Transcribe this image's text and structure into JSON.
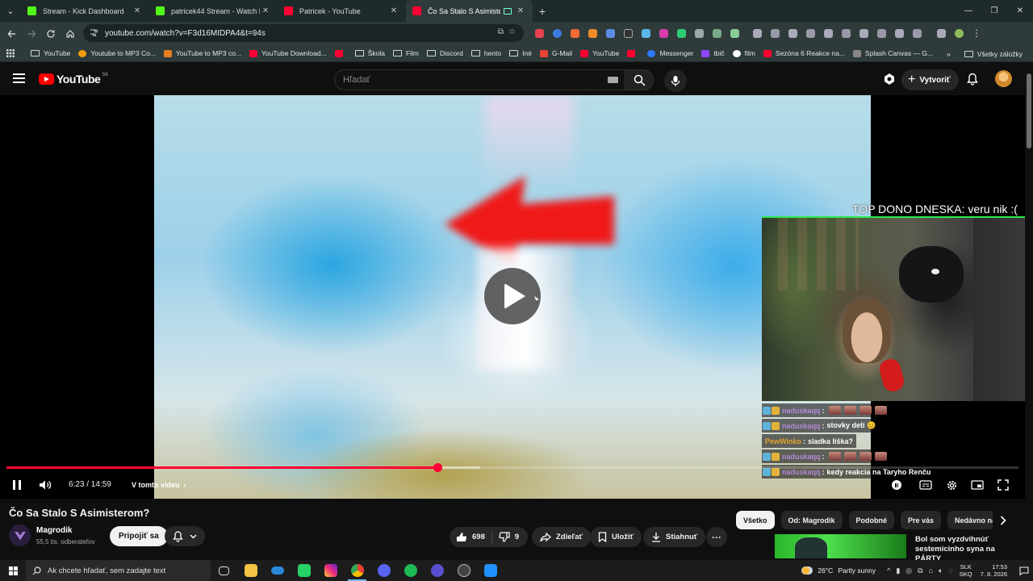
{
  "browser": {
    "tabs": [
      {
        "label": "Stream - Kick Dashboard",
        "favicon_color": "#53fc18",
        "active": false
      },
      {
        "label": "patricek44 Stream - Watch Live",
        "favicon_color": "#53fc18",
        "active": false
      },
      {
        "label": "Patricek - YouTube",
        "favicon_color": "#ff0033",
        "active": false
      },
      {
        "label": "Čo Sa Stalo S Asimisterom?",
        "favicon_color": "#ff0033",
        "active": true
      }
    ],
    "url": "youtube.com/watch?v=F3d16MIDPA4&t=94s",
    "bookmarks": [
      {
        "label": "YouTube",
        "type": "folder"
      },
      {
        "label": "Youtube to MP3 Co...",
        "type": "site",
        "color": "#f39c12"
      },
      {
        "label": "YouTube to MP3 co...",
        "type": "site",
        "color": "#e67e22"
      },
      {
        "label": "YouTube Download...",
        "type": "site",
        "color": "#ff0033"
      },
      {
        "label": "",
        "type": "site",
        "color": "#ff0033"
      },
      {
        "label": "Škola",
        "type": "folder"
      },
      {
        "label": "Film",
        "type": "folder"
      },
      {
        "label": "Discord",
        "type": "folder"
      },
      {
        "label": "hento",
        "type": "folder"
      },
      {
        "label": "Iné",
        "type": "folder"
      },
      {
        "label": "G-Mail",
        "type": "site",
        "color": "#ea4335"
      },
      {
        "label": "YouTube",
        "type": "site",
        "color": "#ff0033"
      },
      {
        "label": "",
        "type": "site",
        "color": "#ff0033"
      },
      {
        "label": "Messenger",
        "type": "site",
        "color": "#2f7bff"
      },
      {
        "label": "tbič",
        "type": "site",
        "color": "#9146ff"
      },
      {
        "label": "film",
        "type": "site",
        "color": "#ffffff"
      },
      {
        "label": "Sezóna 6 Reakce na...",
        "type": "site",
        "color": "#ff0033"
      },
      {
        "label": "Splash Canvas — G...",
        "type": "site",
        "color": "#888888"
      }
    ],
    "all_bookmarks": "Všetky záložky"
  },
  "youtube": {
    "region": "SK",
    "search_placeholder": "Hľadať",
    "create_label": "Vytvoriť"
  },
  "player": {
    "top_dono": "TOP DONO DNESKA: veru nik :(",
    "time": "6:23 / 14:59",
    "chapter": "V tomto videu",
    "played_fraction": 0.426,
    "buffered_fraction": 0.468,
    "chat": [
      {
        "user": "naduskaqq",
        "user_color": "#b58ad8",
        "msg": "",
        "emotes": 4
      },
      {
        "user": "naduskaqq",
        "user_color": "#b58ad8",
        "msg": "stovky deti 😊",
        "emotes": 0
      },
      {
        "user": "PewWinko",
        "user_color": "#e6a52b",
        "msg": "sladka liška?",
        "emotes": 0
      },
      {
        "user": "naduskaqq",
        "user_color": "#b58ad8",
        "msg": "",
        "emotes": 4
      },
      {
        "user": "naduskaqq",
        "user_color": "#b58ad8",
        "msg": "kedy reakcia na Taryho Renču",
        "emotes": 0
      }
    ]
  },
  "video": {
    "title": "Čo Sa Stalo S Asimisterom?",
    "channel": "Magrodik",
    "subscribers": "55,5 tis. odberateľov",
    "join_label": "Pripojiť sa",
    "likes": "698",
    "dislikes": "9",
    "share_label": "Zdieľať",
    "save_label": "Uložiť",
    "download_label": "Stiahnuť"
  },
  "recommendations": {
    "chips": [
      "Všetko",
      "Od: Magrodik",
      "Podobné",
      "Pre vás",
      "Nedávno nahraté"
    ],
    "first_title": "Bol som vyzdvihnúť sestemicinho syna na PÁRTY"
  },
  "taskbar": {
    "search_placeholder": "Ak chcete hľadať, sem zadajte text",
    "weather": "26°C",
    "weather_desc": "Partly sunny",
    "lang_top": "SLK",
    "lang_bottom": "SKQ",
    "time": "17:53",
    "date": "7. 8. 2026",
    "apps": [
      {
        "name": "task-view",
        "color": "#3a3a3a"
      },
      {
        "name": "file-explorer",
        "color": "#f5c243"
      },
      {
        "name": "onedrive",
        "color": "#2b88d8"
      },
      {
        "name": "whatsapp",
        "color": "#25d366"
      },
      {
        "name": "instagram",
        "color": "#d6249f"
      },
      {
        "name": "chrome",
        "color": "#4285f4"
      },
      {
        "name": "discord",
        "color": "#5865f2"
      },
      {
        "name": "spotify",
        "color": "#1db954"
      },
      {
        "name": "app-purple",
        "color": "#5a4fcf"
      },
      {
        "name": "app-recorder",
        "color": "#444444"
      },
      {
        "name": "app-blue",
        "color": "#1e90ff"
      }
    ]
  }
}
